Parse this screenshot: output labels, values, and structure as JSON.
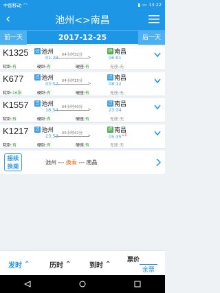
{
  "status": {
    "carrier": "中国移动",
    "time": "13:22"
  },
  "header": {
    "title": "池州<>南昌"
  },
  "datebar": {
    "prev": "前一天",
    "date": "2017-12-25",
    "next": "后一天"
  },
  "trains": [
    {
      "no": "K1325",
      "from_badge": "过",
      "from": "池州",
      "dep": "01:29",
      "duration": "04小时32分",
      "to_badge": "终",
      "to": "南昌",
      "arr": "06:01",
      "seats": [
        {
          "name": "软卧:",
          "status": "有"
        },
        {
          "name": "硬卧:",
          "status": "有"
        },
        {
          "name": "硬座:",
          "status": "有"
        },
        {
          "name": "",
          "status": "无座:无"
        }
      ]
    },
    {
      "no": "K677",
      "from_badge": "过",
      "from": "池州",
      "dep": "03:57",
      "duration": "04小时15分",
      "to_badge": "过",
      "to": "南昌",
      "arr": "08:12",
      "seats": [
        {
          "name": "软卧:",
          "status": "16张"
        },
        {
          "name": "硬卧:",
          "status": "有"
        },
        {
          "name": "硬座:",
          "status": "有"
        },
        {
          "name": "",
          "status": "无座:无"
        }
      ]
    },
    {
      "no": "K1557",
      "from_badge": "过",
      "from": "池州",
      "dep": "18:54",
      "duration": "04小时40分",
      "to_badge": "过",
      "to": "南昌",
      "arr": "23:34",
      "seats": [
        {
          "name": "软卧:",
          "status": "有"
        },
        {
          "name": "硬卧:",
          "status": "有"
        },
        {
          "name": "硬座:",
          "status": "有"
        },
        {
          "name": "",
          "status": "无座:无"
        }
      ]
    },
    {
      "no": "K1217",
      "from_badge": "过",
      "from": "池州",
      "dep": "23:53",
      "duration": "05小时42分",
      "to_badge": "终",
      "to": "南昌",
      "arr": "05:35",
      "arr_plus": "+1",
      "seats": [
        {
          "name": "软卧:",
          "status": "有"
        },
        {
          "name": "硬卧:",
          "status": "有"
        },
        {
          "name": "硬座:",
          "status": "有"
        },
        {
          "name": "",
          "status": "无座:无"
        }
      ]
    }
  ],
  "transfer": {
    "tag_line1": "接续",
    "tag_line2": "换乘",
    "from": "池州",
    "sep1": "---",
    "mid": "换乘",
    "sep2": "---",
    "to": "南昌"
  },
  "bottom": {
    "depart": "发时",
    "duration": "历时",
    "arrive": "到时",
    "price": "票价",
    "remain": "余票"
  },
  "colors": {
    "primary": "#1e96e6",
    "accent": "#3a9ee8",
    "green": "#4cb34c"
  }
}
